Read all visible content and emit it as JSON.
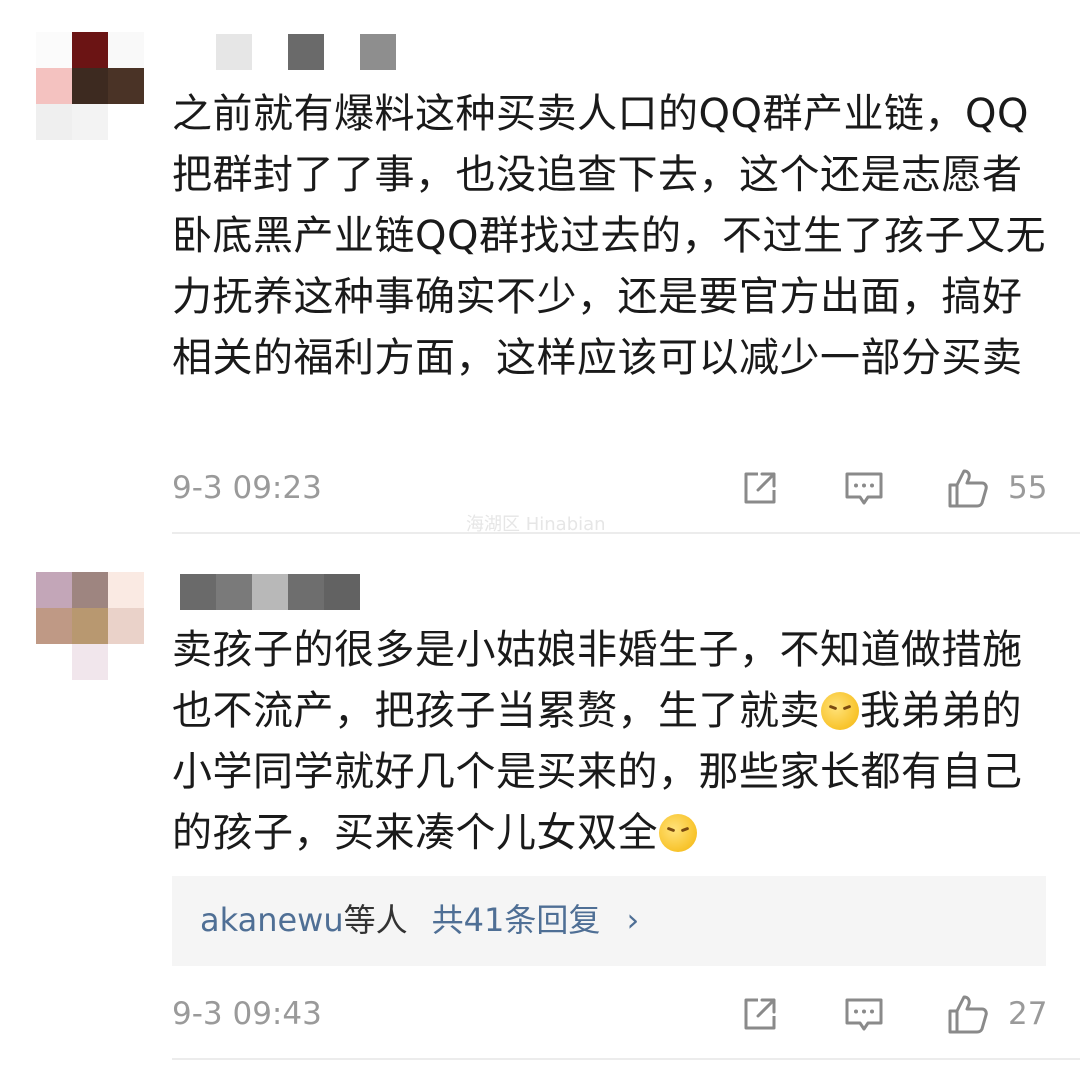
{
  "colors": {
    "link_blue": "#4f6f95",
    "meta_gray": "#9a9a9a",
    "text": "#1a1a1a"
  },
  "comments": [
    {
      "text": "之前就有爆料这种买卖人口的QQ群产业链，QQ把群封了了事，也没追查下去，这个还是志愿者卧底黑产业链QQ群找过去的，不过生了孩子又无力抚养这种事确实不少，还是要官方出面，搞好相关的福利方面，这样应该可以减少一部分买卖",
      "time": "9-3 09:23",
      "like_count": "55",
      "icons": [
        "share-icon",
        "comment-icon",
        "thumbs-up-icon"
      ]
    },
    {
      "text_parts": [
        "卖孩子的很多是小姑娘非婚生子，不知道做措施也不流产，把孩子当累赘，生了就卖",
        "我弟弟的小学同学就好几个是买来的，那些家长都有自己的孩子，买来凑个儿女双全"
      ],
      "emoji": "thinking-emoji",
      "time": "9-3 09:43",
      "like_count": "27",
      "replies": {
        "users": "akanewu",
        "suffix": "等人",
        "count_label": "共41条回复",
        "chevron": "›"
      },
      "icons": [
        "share-icon",
        "comment-icon",
        "thumbs-up-icon"
      ]
    }
  ],
  "watermark": "海湖区 Hinabian"
}
